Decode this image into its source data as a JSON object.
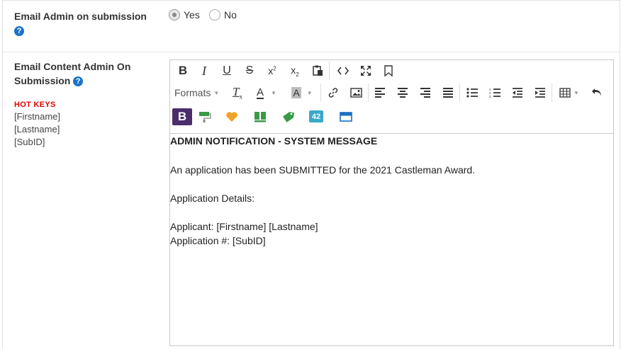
{
  "field1": {
    "label": "Email Admin on submission",
    "help": "?",
    "options": [
      {
        "label": "Yes",
        "checked": true
      },
      {
        "label": "No",
        "checked": false
      }
    ]
  },
  "field2": {
    "label_line1": "Email Content Admin On",
    "label_line2": "Submission",
    "help": "?",
    "hotkeys_title": "HOT KEYS",
    "hotkeys": [
      "[Firstname]",
      "[Lastname]",
      "[SubID]"
    ]
  },
  "toolbar": {
    "formats_label": "Formats",
    "badge_42": "42",
    "b_badge": "B"
  },
  "editor_content": {
    "heading": "ADMIN NOTIFICATION - SYSTEM MESSAGE",
    "line1": "An application has been SUBMITTED for the 2021 Castleman Award.",
    "line2": "Application Details:",
    "line3": "Applicant: [Firstname] [Lastname]",
    "line4": "Application #: [SubID]"
  },
  "colors": {
    "help_blue": "#1a73c9",
    "hotkeys_red": "#dd0000",
    "purple_badge": "#4a2e6b",
    "teal_badge": "#3aa8c9"
  }
}
